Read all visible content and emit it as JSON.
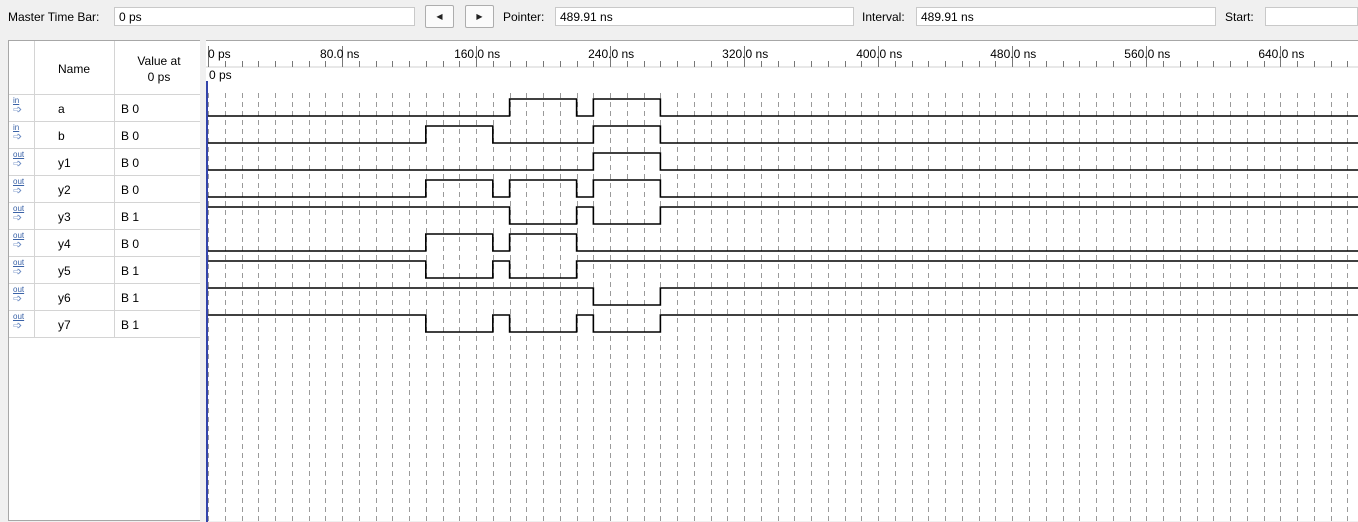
{
  "toolbar": {
    "master_time_bar_label": "Master Time Bar:",
    "master_time_bar_value": "0 ps",
    "pointer_label": "Pointer:",
    "pointer_value": "489.91 ns",
    "interval_label": "Interval:",
    "interval_value": "489.91 ns",
    "start_label": "Start:",
    "start_value": "",
    "prev_icon": "triangle-left-icon",
    "next_icon": "triangle-right-icon"
  },
  "signal_list": {
    "name_header": "Name",
    "value_header_line1": "Value at",
    "value_header_line2": "0 ps",
    "signals": [
      {
        "io": "in",
        "name": "a",
        "value": "B 0"
      },
      {
        "io": "in",
        "name": "b",
        "value": "B 0"
      },
      {
        "io": "out",
        "name": "y1",
        "value": "B 0"
      },
      {
        "io": "out",
        "name": "y2",
        "value": "B 0"
      },
      {
        "io": "out",
        "name": "y3",
        "value": "B 1"
      },
      {
        "io": "out",
        "name": "y4",
        "value": "B 0"
      },
      {
        "io": "out",
        "name": "y5",
        "value": "B 1"
      },
      {
        "io": "out",
        "name": "y6",
        "value": "B 1"
      },
      {
        "io": "out",
        "name": "y7",
        "value": "B 1"
      }
    ]
  },
  "timeline": {
    "cursor_label": "0 ps",
    "unit": "ns",
    "tick_labels": [
      {
        "t": 0,
        "label": "0 ps"
      },
      {
        "t": 80,
        "label": "80.0 ns"
      },
      {
        "t": 160,
        "label": "160.0 ns"
      },
      {
        "t": 240,
        "label": "240.0 ns"
      },
      {
        "t": 320,
        "label": "320.0 ns"
      },
      {
        "t": 400,
        "label": "400.0 ns"
      },
      {
        "t": 480,
        "label": "480.0 ns"
      },
      {
        "t": 560,
        "label": "560.0 ns"
      },
      {
        "t": 640,
        "label": "640.0 ns"
      }
    ],
    "grid_step_ns": 10,
    "colors": {
      "grid": "#9a9a9a",
      "wave": "#000000",
      "cursor": "#3344aa"
    }
  },
  "waveforms": [
    {
      "name": "a",
      "initial": 0,
      "transitions": [
        180,
        220,
        230,
        270
      ]
    },
    {
      "name": "b",
      "initial": 0,
      "transitions": [
        130,
        170,
        230,
        270
      ]
    },
    {
      "name": "y1",
      "initial": 0,
      "transitions": [
        230,
        270
      ]
    },
    {
      "name": "y2",
      "initial": 0,
      "transitions": [
        130,
        170,
        180,
        220,
        230,
        270
      ]
    },
    {
      "name": "y3",
      "initial": 1,
      "transitions": [
        180,
        220,
        230,
        270
      ]
    },
    {
      "name": "y4",
      "initial": 0,
      "transitions": [
        130,
        170,
        180,
        220
      ]
    },
    {
      "name": "y5",
      "initial": 1,
      "transitions": [
        130,
        170,
        180,
        220
      ]
    },
    {
      "name": "y6",
      "initial": 1,
      "transitions": [
        230,
        270
      ]
    },
    {
      "name": "y7",
      "initial": 1,
      "transitions": [
        130,
        170,
        180,
        220,
        230,
        270
      ]
    }
  ]
}
